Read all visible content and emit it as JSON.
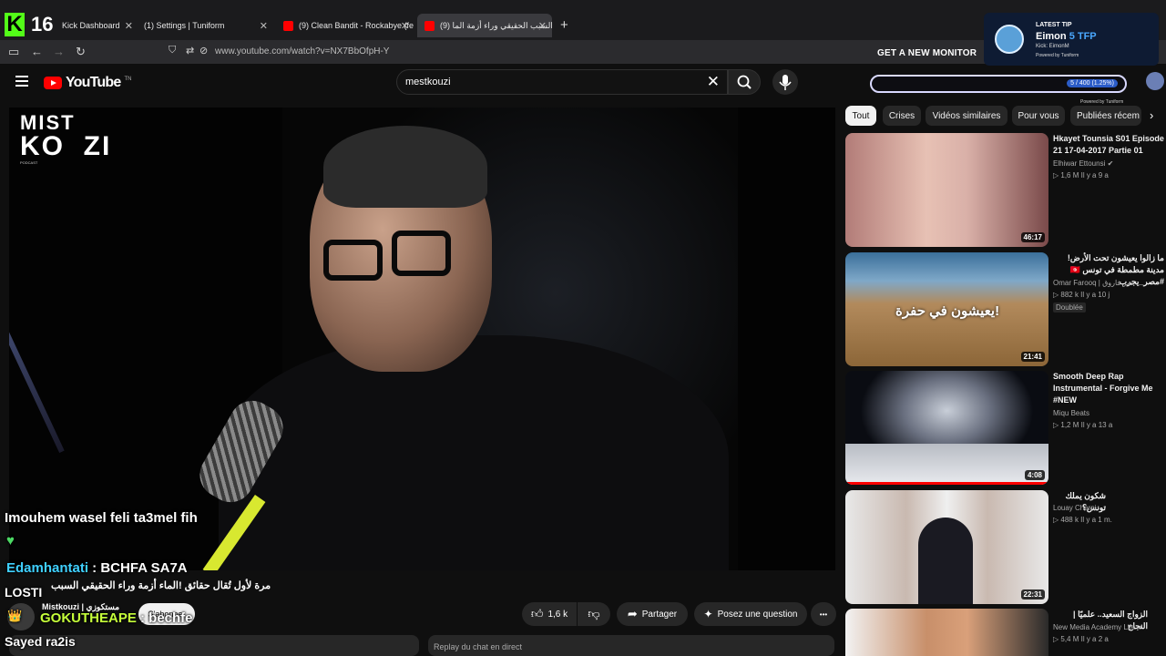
{
  "browser": {
    "kick_counter": "16",
    "tabs": [
      {
        "label": "Kick Dashboard",
        "color": "#53fc18"
      },
      {
        "label": "(1) Settings | Tuniform",
        "color": "#444444"
      },
      {
        "label": "(9) Clean Bandit - Rockabye (fe",
        "color": "#ff0000"
      },
      {
        "label": "(9) السبب الحقيقي وراء أزمة الما",
        "color": "#ff0000"
      }
    ],
    "new_tab": "+",
    "url": "www.youtube.com/watch?v=NX7BbOfpH-Y",
    "monitor_text": "GET A NEW MONITOR"
  },
  "tip_overlay": {
    "label": "LATEST TIP",
    "name": "Eimon",
    "amount": "5 TFP",
    "kick": "Kick: EimonM",
    "powered": "Powered by Tuniform"
  },
  "goal": {
    "text": "5 / 400 (1.25%)",
    "progress_percent": 1.25,
    "powered": "Powered by Tuniform"
  },
  "youtube": {
    "logo": "YouTube",
    "logo_suffix": "TN",
    "search_value": "mestkouzi"
  },
  "video": {
    "logo_line1": "MIST",
    "logo_line2": "KO  ZI",
    "logo_line3": "PODCAST"
  },
  "chat": {
    "line1": "Imouhem wasel feli ta3mel fih",
    "heart": "♥",
    "line2_user": "Edamhantati",
    "line2_msg": " : BCHFA SA7A",
    "line3": "LOSTI",
    "line4_user": "GOKUTHEAPE",
    "line4_msg": " : bechfe",
    "line5": "Sayed ra2is"
  },
  "below_video": {
    "title": "مرة لأول تُقال حقائق !الماء أزمة وراء الحقيقي السبب",
    "channel": "Mistkouzi | مستكوزي",
    "subscribe": "S'abonner",
    "likes": "1,6 k",
    "share": "Partager",
    "ask": "Posez une question",
    "more": "•••",
    "replay": "Replay du chat en direct"
  },
  "chips": [
    "Tout",
    "Crises",
    "Vidéos similaires",
    "Pour vous",
    "Publiées récem"
  ],
  "related": [
    {
      "title": "Hkayet Tounsia S01 Episode 21 17-04-2017 Partie 01",
      "channel": "Elhiwar Ettounsi ✔",
      "meta": "▷ 1,6 M  Il y a 9 a",
      "duration": "46:17",
      "badge": ""
    },
    {
      "title": "ما زالوا يعيشون تحت الأرض! مدينة مطمطة في تونس 🇹🇳 #مصر_يجرب",
      "channel": "Omar Farooq | عمر فاروق",
      "meta": "▷ 882 k  Il y a 10 j",
      "duration": "21:41",
      "badge": "Doublée"
    },
    {
      "title": "Smooth Deep Rap Instrumental - Forgive Me #NEW",
      "channel": "Miqu Beats",
      "meta": "▷ 1,2 M  Il y a 13 a",
      "duration": "4:08",
      "badge": ""
    },
    {
      "title": "شكون يملك تونس؟",
      "channel": "Louay Cherni",
      "meta": "▷ 488 k  Il y a 1 m.",
      "duration": "22:31",
      "badge": ""
    },
    {
      "title": "الزواج السعيد.. علميًا | النجاح",
      "channel": "New Media Academy Life ✔",
      "meta": "▷ 5,4 M  Il y a 2 a",
      "duration": "",
      "badge": ""
    }
  ],
  "thumb_text": {
    "t2": "يعيشون في حفرة!"
  }
}
